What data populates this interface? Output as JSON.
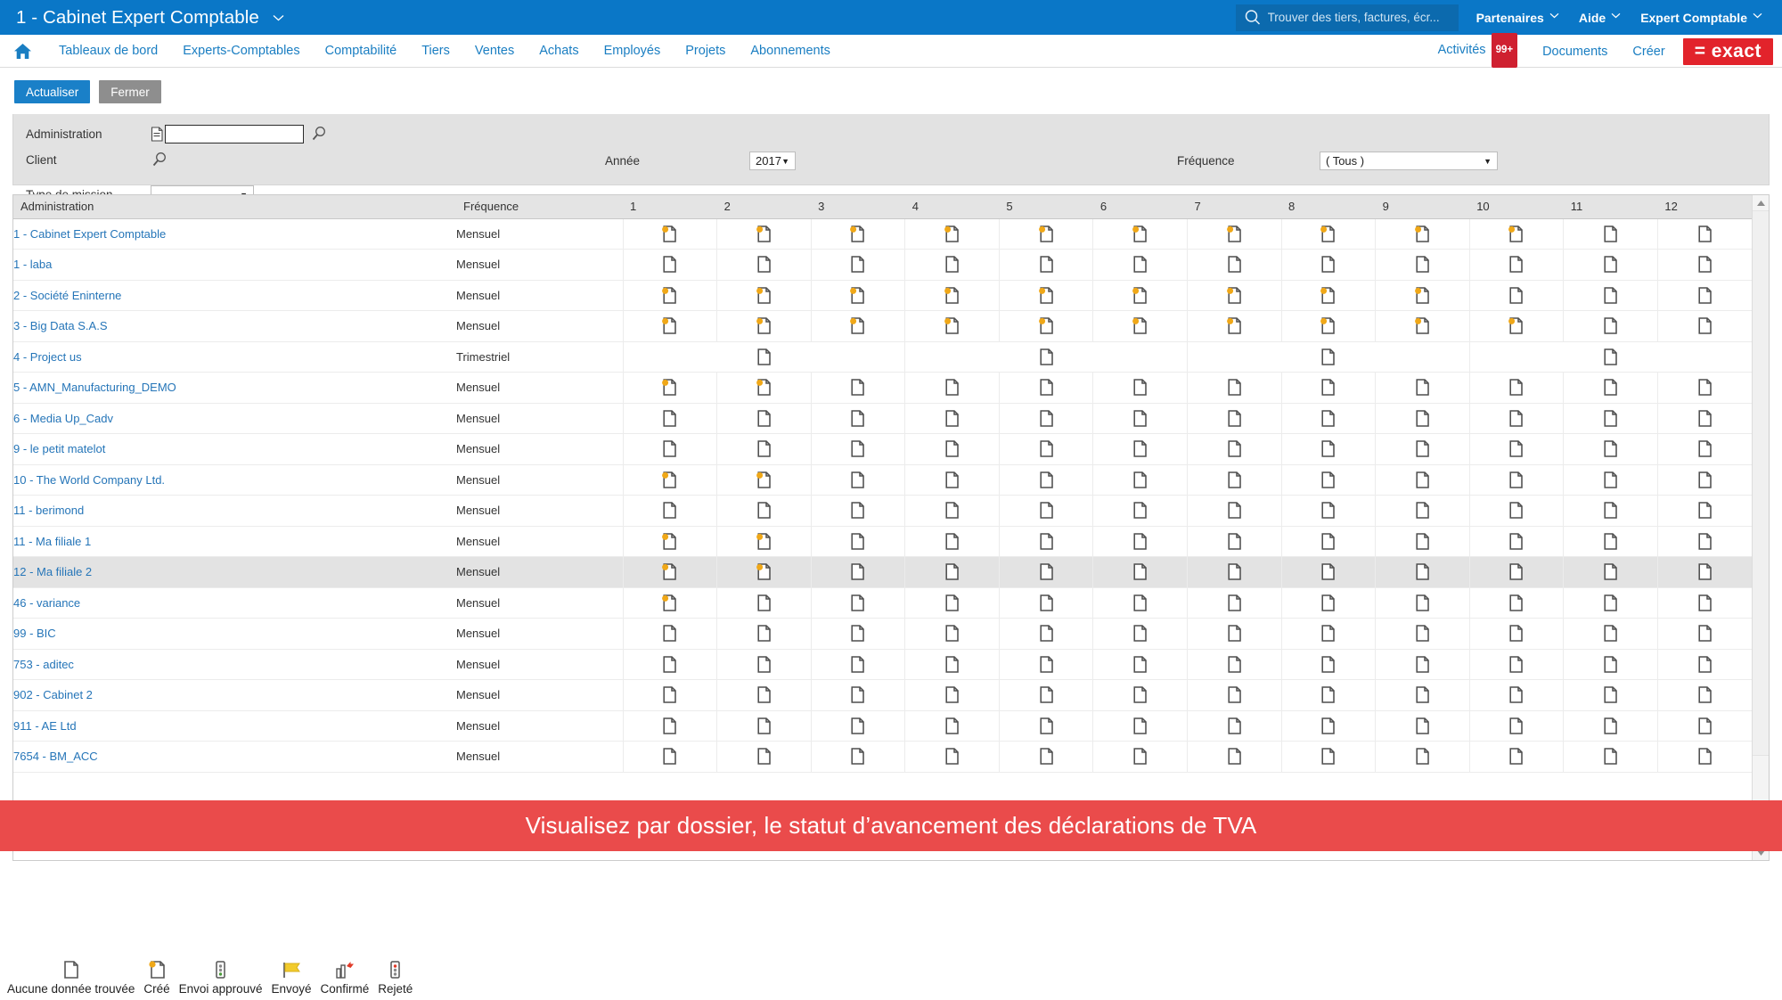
{
  "topbar": {
    "title": "1 - Cabinet Expert Comptable",
    "search_placeholder": "Trouver des tiers, factures, écr...",
    "menus": [
      {
        "label": "Partenaires"
      },
      {
        "label": "Aide"
      },
      {
        "label": "Expert Comptable"
      }
    ],
    "colors": {
      "bar": "#0a77c7",
      "search_bg": "#0c6aae"
    }
  },
  "nav": {
    "home_icon": "home-icon",
    "items": [
      {
        "label": "Tableaux de bord"
      },
      {
        "label": "Experts-Comptables"
      },
      {
        "label": "Comptabilité"
      },
      {
        "label": "Tiers"
      },
      {
        "label": "Ventes"
      },
      {
        "label": "Achats"
      },
      {
        "label": "Employés"
      },
      {
        "label": "Projets"
      },
      {
        "label": "Abonnements"
      }
    ],
    "right": [
      {
        "label": "Activités",
        "badge": "99+"
      },
      {
        "label": "Documents"
      },
      {
        "label": "Créer"
      }
    ],
    "logo": "= exact",
    "logo_color": "#e2232b"
  },
  "toolbar": {
    "refresh_label": "Actualiser",
    "close_label": "Fermer"
  },
  "filters": {
    "administration_label": "Administration",
    "administration_value": "",
    "client_label": "Client",
    "type_mission_label": "Type de mission",
    "type_mission_value": "",
    "annee_label": "Année",
    "annee_value": "2017",
    "annee_options": [
      "2017"
    ],
    "frequence_label": "Fréquence",
    "frequence_value": "( Tous )",
    "frequence_options": [
      "( Tous )"
    ]
  },
  "grid": {
    "columns": [
      "Administration",
      "Fréquence",
      "1",
      "2",
      "3",
      "4",
      "5",
      "6",
      "7",
      "8",
      "9",
      "10",
      "11",
      "12"
    ],
    "rows": [
      {
        "administration": "1 - Cabinet Expert Comptable",
        "frequence": "Mensuel",
        "months": [
          "created",
          "created",
          "created",
          "created",
          "created",
          "created",
          "created",
          "created",
          "created",
          "created",
          "none",
          "none"
        ]
      },
      {
        "administration": "1 - laba",
        "frequence": "Mensuel",
        "months": [
          "none",
          "none",
          "none",
          "none",
          "none",
          "none",
          "none",
          "none",
          "none",
          "none",
          "none",
          "none"
        ]
      },
      {
        "administration": "2 - Société Eninterne",
        "frequence": "Mensuel",
        "months": [
          "created",
          "created",
          "created",
          "created",
          "created",
          "created",
          "created",
          "created",
          "created",
          "none",
          "none",
          "none"
        ]
      },
      {
        "administration": "3 - Big Data S.A.S",
        "frequence": "Mensuel",
        "months": [
          "created",
          "created",
          "created",
          "created",
          "created",
          "created",
          "created",
          "created",
          "created",
          "created",
          "none",
          "none"
        ]
      },
      {
        "administration": "4 - Project us",
        "frequence": "Trimestriel",
        "months": [
          "q",
          "q",
          "q",
          "q"
        ]
      },
      {
        "administration": "5 - AMN_Manufacturing_DEMO",
        "frequence": "Mensuel",
        "months": [
          "created",
          "created",
          "none",
          "none",
          "none",
          "none",
          "none",
          "none",
          "none",
          "none",
          "none",
          "none"
        ]
      },
      {
        "administration": "6 - Media Up_Cadv",
        "frequence": "Mensuel",
        "months": [
          "none",
          "none",
          "none",
          "none",
          "none",
          "none",
          "none",
          "none",
          "none",
          "none",
          "none",
          "none"
        ]
      },
      {
        "administration": "9 - le petit matelot",
        "frequence": "Mensuel",
        "months": [
          "none",
          "none",
          "none",
          "none",
          "none",
          "none",
          "none",
          "none",
          "none",
          "none",
          "none",
          "none"
        ]
      },
      {
        "administration": "10 - The World Company Ltd.",
        "frequence": "Mensuel",
        "months": [
          "created",
          "created",
          "none",
          "none",
          "none",
          "none",
          "none",
          "none",
          "none",
          "none",
          "none",
          "none"
        ]
      },
      {
        "administration": "11 - berimond",
        "frequence": "Mensuel",
        "months": [
          "none",
          "none",
          "none",
          "none",
          "none",
          "none",
          "none",
          "none",
          "none",
          "none",
          "none",
          "none"
        ]
      },
      {
        "administration": "11 - Ma filiale 1",
        "frequence": "Mensuel",
        "months": [
          "created",
          "created",
          "none",
          "none",
          "none",
          "none",
          "none",
          "none",
          "none",
          "none",
          "none",
          "none"
        ]
      },
      {
        "administration": "12 - Ma filiale 2",
        "frequence": "Mensuel",
        "months": [
          "created",
          "created",
          "none",
          "none",
          "none",
          "none",
          "none",
          "none",
          "none",
          "none",
          "none",
          "none"
        ],
        "selected": true
      },
      {
        "administration": "46 - variance",
        "frequence": "Mensuel",
        "months": [
          "created",
          "none",
          "none",
          "none",
          "none",
          "none",
          "none",
          "none",
          "none",
          "none",
          "none",
          "none"
        ]
      },
      {
        "administration": "99 - BIC",
        "frequence": "Mensuel",
        "months": [
          "none",
          "none",
          "none",
          "none",
          "none",
          "none",
          "none",
          "none",
          "none",
          "none",
          "none",
          "none"
        ]
      },
      {
        "administration": "753 - aditec",
        "frequence": "Mensuel",
        "months": [
          "none",
          "none",
          "none",
          "none",
          "none",
          "none",
          "none",
          "none",
          "none",
          "none",
          "none",
          "none"
        ]
      },
      {
        "administration": "902 - Cabinet 2",
        "frequence": "Mensuel",
        "months": [
          "none",
          "none",
          "none",
          "none",
          "none",
          "none",
          "none",
          "none",
          "none",
          "none",
          "none",
          "none"
        ]
      },
      {
        "administration": "911 - AE Ltd",
        "frequence": "Mensuel",
        "months": [
          "none",
          "none",
          "none",
          "none",
          "none",
          "none",
          "none",
          "none",
          "none",
          "none",
          "none",
          "none"
        ]
      },
      {
        "administration": "7654 - BM_ACC",
        "frequence": "Mensuel",
        "months": [
          "none",
          "none",
          "none",
          "none",
          "none",
          "none",
          "none",
          "none",
          "none",
          "none",
          "none",
          "none"
        ]
      }
    ]
  },
  "banner": {
    "text": "Visualisez par dossier, le statut d’avancement des déclarations de TVA",
    "color": "#ea4b4b"
  },
  "legend": [
    {
      "label": "Aucune donnée trouvée",
      "icon": "document-plain-icon"
    },
    {
      "label": "Créé",
      "icon": "document-created-icon"
    },
    {
      "label": "Envoi approuvé",
      "icon": "traffic-light-green-icon"
    },
    {
      "label": "Envoyé",
      "icon": "flag-yellow-icon"
    },
    {
      "label": "Confirmé",
      "icon": "chart-check-icon"
    },
    {
      "label": "Rejeté",
      "icon": "traffic-light-red-icon"
    }
  ]
}
